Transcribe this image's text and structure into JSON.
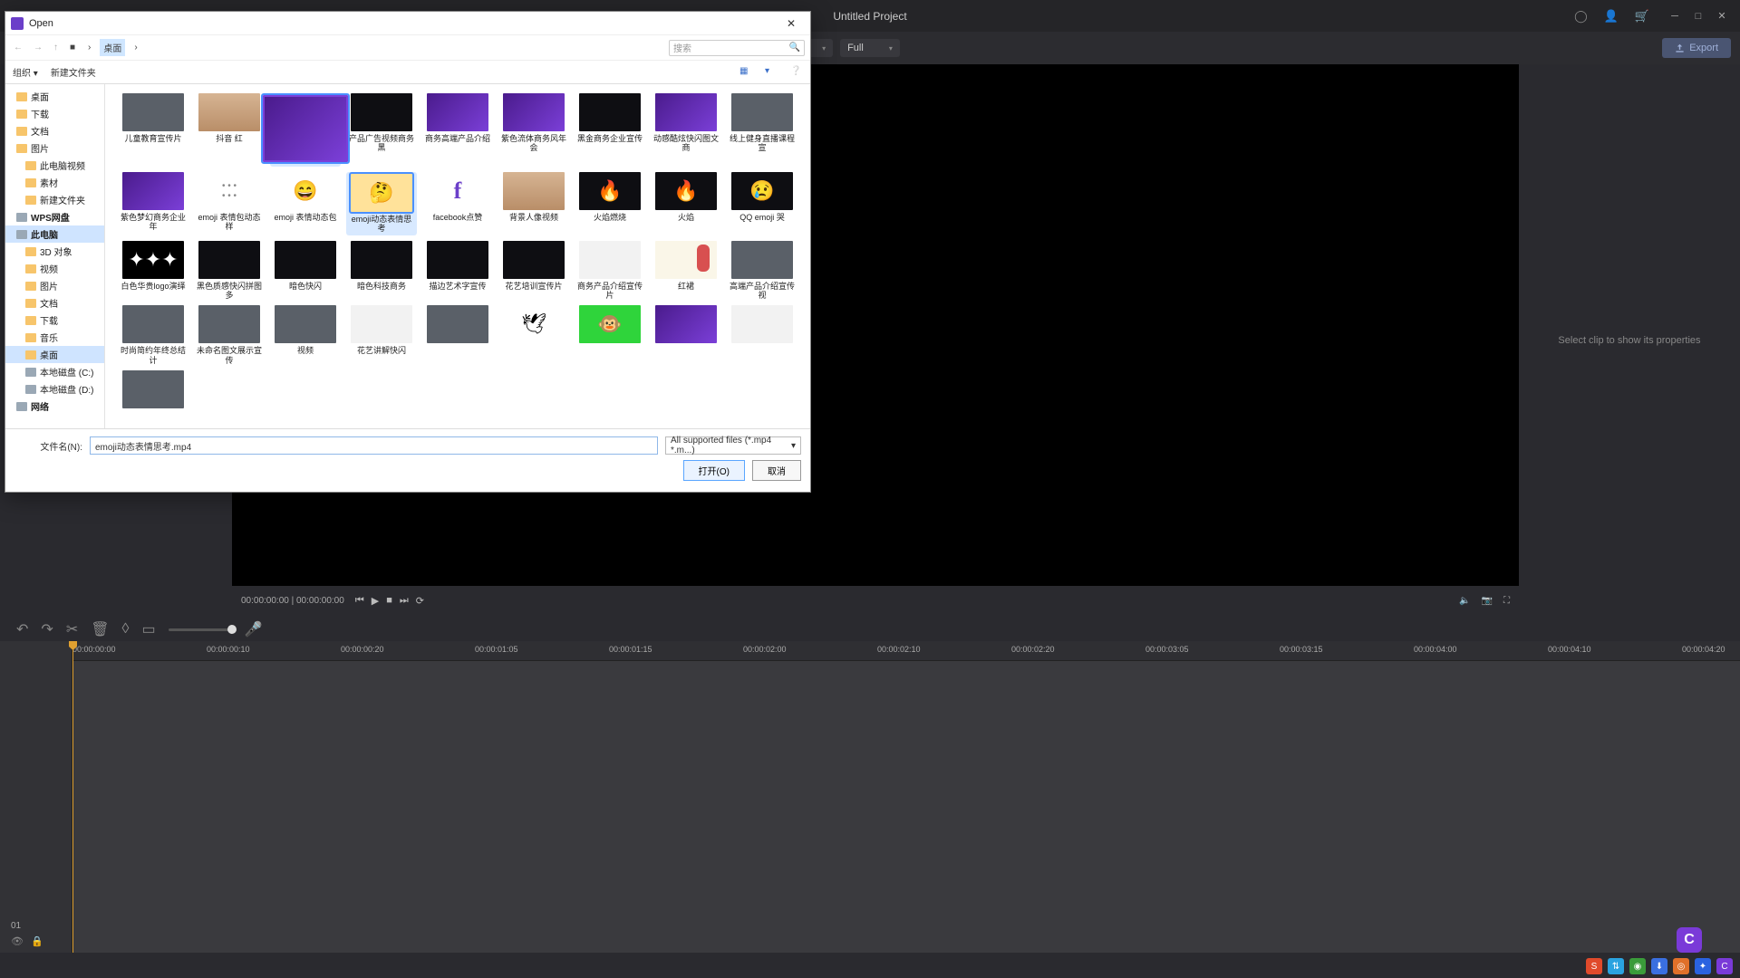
{
  "titlebar": {
    "project_title": "Untitled Project",
    "min_tip": "Minimize",
    "max_tip": "Maximize",
    "close_tip": "Close"
  },
  "toolbar": {
    "resolution_label": "Full",
    "export_label": "Export"
  },
  "preview": {
    "timecode": "00:00:00:00 | 00:00:00:00"
  },
  "properties": {
    "placeholder": "Select clip to show its properties"
  },
  "timeline": {
    "track_label": "01",
    "ruler": [
      "00:00:00:00",
      "00:00:00:10",
      "00:00:00:20",
      "00:00:01:05",
      "00:00:01:15",
      "00:00:02:00",
      "00:00:02:10",
      "00:00:02:20",
      "00:00:03:05",
      "00:00:03:15",
      "00:00:04:00",
      "00:00:04:10",
      "00:00:04:20"
    ]
  },
  "dialog": {
    "title": "Open",
    "toolbar_organize": "组织 ▾",
    "toolbar_newfolder": "新建文件夹",
    "search_placeholder": "搜索",
    "sidebar": [
      {
        "label": "桌面",
        "type": "folder",
        "ind": 0
      },
      {
        "label": "下载",
        "type": "folder",
        "ind": 0
      },
      {
        "label": "文档",
        "type": "folder",
        "ind": 0
      },
      {
        "label": "图片",
        "type": "folder",
        "ind": 0
      },
      {
        "label": "此电脑视频",
        "type": "folder",
        "ind": 1
      },
      {
        "label": "素材",
        "type": "folder",
        "ind": 1
      },
      {
        "label": "新建文件夹",
        "type": "folder",
        "ind": 1
      },
      {
        "label": "WPS网盘",
        "type": "drive",
        "ind": 0,
        "bold": true
      },
      {
        "label": "此电脑",
        "type": "drive",
        "ind": 0,
        "bold": true,
        "selected": true
      },
      {
        "label": "3D 对象",
        "type": "folder",
        "ind": 1
      },
      {
        "label": "视频",
        "type": "folder",
        "ind": 1
      },
      {
        "label": "图片",
        "type": "folder",
        "ind": 1
      },
      {
        "label": "文档",
        "type": "folder",
        "ind": 1
      },
      {
        "label": "下载",
        "type": "folder",
        "ind": 1
      },
      {
        "label": "音乐",
        "type": "folder",
        "ind": 1
      },
      {
        "label": "桌面",
        "type": "folder",
        "ind": 1,
        "selected": true
      },
      {
        "label": "本地磁盘 (C:)",
        "type": "drive",
        "ind": 1
      },
      {
        "label": "本地磁盘 (D:)",
        "type": "drive",
        "ind": 1
      },
      {
        "label": "网络",
        "type": "drive",
        "ind": 0,
        "bold": true
      }
    ],
    "grid": [
      {
        "n": "儿童教育宣传片",
        "cls": "t-grey"
      },
      {
        "n": "抖音 红",
        "cls": "t-skin"
      },
      {
        "n": "",
        "cls": "t-purple t-logo",
        "selected": true
      },
      {
        "n": "产品广告视频商务黑",
        "cls": "t-dark"
      },
      {
        "n": "商务高端产品介绍",
        "cls": "t-purple"
      },
      {
        "n": "紫色流体商务风年会",
        "cls": "t-purple"
      },
      {
        "n": "黑金商务企业宣传",
        "cls": "t-dark"
      },
      {
        "n": "动感酷炫快闪图文商",
        "cls": "t-purple"
      },
      {
        "n": "线上健身直播课程宣",
        "cls": "t-grey"
      },
      {
        "n": "紫色梦幻商务企业年",
        "cls": "t-purple"
      },
      {
        "n": "emoji 表情包动态样",
        "cls": "t-dots"
      },
      {
        "n": "emoji 表情动态包",
        "cls": "t-emoji",
        "glyph": "😄"
      },
      {
        "n": "emoji动态表情思考",
        "cls": "t-emoji-y",
        "glyph": "🤔",
        "selected": true
      },
      {
        "n": "facebook点赞",
        "cls": "t-facebook"
      },
      {
        "n": "背景人像视频",
        "cls": "t-skin"
      },
      {
        "n": "火焰燃烧",
        "cls": "t-dark",
        "glyph": "🔥"
      },
      {
        "n": "火焰",
        "cls": "t-dark",
        "glyph": "🔥"
      },
      {
        "n": "QQ emoji 哭",
        "cls": "t-dark",
        "glyph": "😢"
      },
      {
        "n": "白色华贵logo演绎",
        "cls": "t-mask",
        "glyph": "✦✦✦"
      },
      {
        "n": "黑色质感快闪拼图多",
        "cls": "t-dark"
      },
      {
        "n": "暗色快闪",
        "cls": "t-dark"
      },
      {
        "n": "暗色科技商务",
        "cls": "t-dark"
      },
      {
        "n": "描边艺术字宣传",
        "cls": "t-dark"
      },
      {
        "n": "花艺培训宣传片",
        "cls": "t-dark"
      },
      {
        "n": "商务产品介绍宣传片",
        "cls": "t-white"
      },
      {
        "n": "红裙",
        "cls": "t-drawing"
      },
      {
        "n": "高端产品介绍宣传视",
        "cls": "t-grey"
      },
      {
        "n": "时尚简约年终总结计",
        "cls": "t-grey"
      },
      {
        "n": "未命名图文展示宣传",
        "cls": "t-grey"
      },
      {
        "n": "视频",
        "cls": "t-grey"
      },
      {
        "n": "花艺讲解快闪",
        "cls": "t-white"
      },
      {
        "n": "",
        "cls": "t-grey"
      },
      {
        "n": "",
        "cls": "t-bird",
        "glyph": "🕊"
      },
      {
        "n": "",
        "cls": "t-green",
        "glyph": "🐵"
      },
      {
        "n": "",
        "cls": "t-purple"
      },
      {
        "n": "",
        "cls": "t-white"
      },
      {
        "n": "",
        "cls": "t-grey"
      }
    ],
    "filename_label": "文件名(N):",
    "filename_value": "emoji动态表情思考.mp4",
    "filter_value": "All supported files (*.mp4 *.m...)",
    "open_btn": "打开(O)",
    "cancel_btn": "取消"
  },
  "tray": {
    "items": [
      "S",
      "⇅",
      "◉",
      "⬇",
      "◎",
      "✦",
      "C"
    ],
    "colors": [
      "#e04a2b",
      "#2aa3e0",
      "#3a9b3a",
      "#3a6fe0",
      "#e0702a",
      "#2a62e0",
      "#7a3ad8"
    ]
  }
}
